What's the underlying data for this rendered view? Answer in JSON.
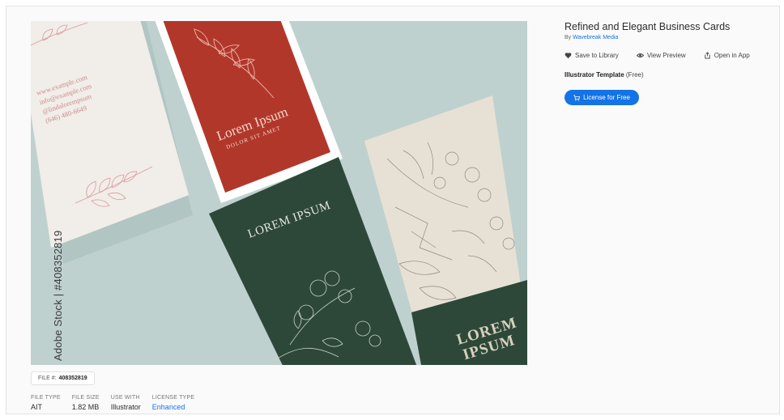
{
  "preview": {
    "card1_lines": [
      "www.example.com",
      "info@example.com",
      "@lindalorempsum",
      "(646) 480-6649"
    ],
    "card2_title": "Lorem Ipsum",
    "card2_sub": "DOLOR SIT AMET",
    "card3_title": "LOREM IPSUM",
    "card4_lines": [
      "LOREM",
      "IPSUM"
    ],
    "watermark": "Adobe Stock | #408352819",
    "colors": {
      "red": "#b2372b",
      "green": "#2d4839",
      "cream": "#e7e1d5",
      "background": "#bfd1cf"
    }
  },
  "file_chip": {
    "label": "FILE #:",
    "value": "408352819"
  },
  "meta": [
    {
      "label": "FILE TYPE",
      "value": "AIT"
    },
    {
      "label": "FILE SIZE",
      "value": "1.82 MB"
    },
    {
      "label": "USE WITH",
      "value": "Illustrator"
    },
    {
      "label": "LICENSE TYPE",
      "value": "Enhanced"
    }
  ],
  "details": {
    "title": "Refined and Elegant Business Cards",
    "by_prefix": "By",
    "author": "Wavebreak Media",
    "actions": [
      {
        "label": "Save to Library",
        "icon": "heart-icon"
      },
      {
        "label": "View Preview",
        "icon": "eye-icon"
      },
      {
        "label": "Open in App",
        "icon": "open-in-app-icon"
      }
    ],
    "template_type": "Illustrator Template",
    "template_price": "(Free)",
    "license_button": "License for Free",
    "accent": "#1473e6"
  }
}
